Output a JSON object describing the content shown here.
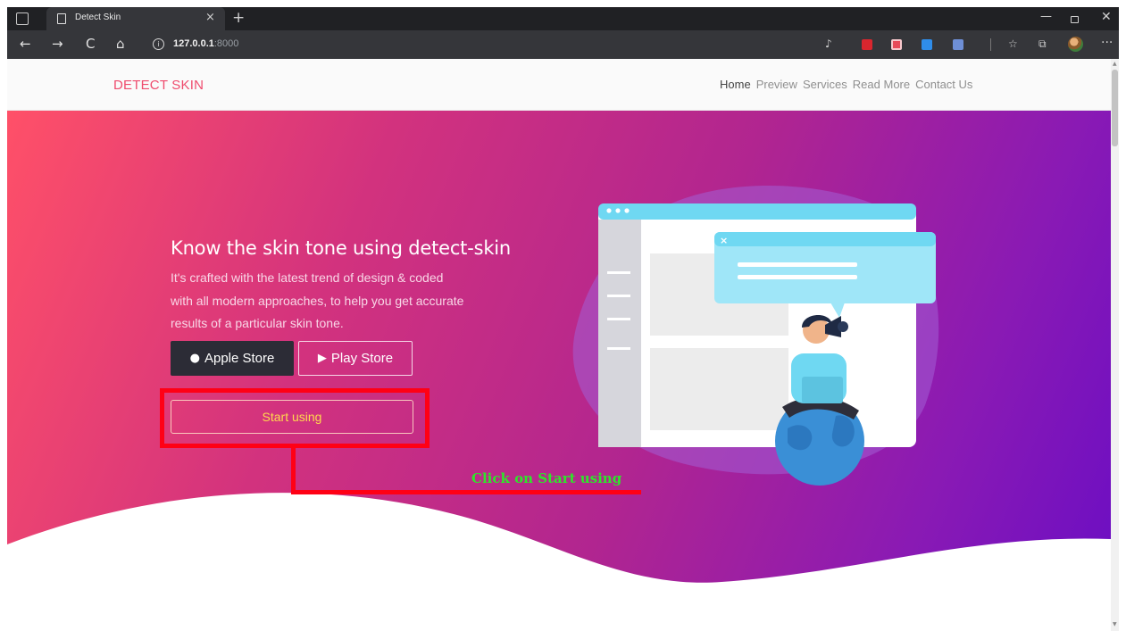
{
  "browser": {
    "tab_title": "Detect Skin",
    "tab_close": "×",
    "new_tab": "+",
    "address_host": "127.0.0.1",
    "address_port": ":8000",
    "nav_back": "←",
    "nav_forward": "→",
    "nav_reload": "C",
    "nav_home": "⌂",
    "menu": "···"
  },
  "site": {
    "brand": "DETECT SKIN",
    "nav": [
      "Home",
      "Preview",
      "Services",
      "Read More",
      "Contact Us"
    ]
  },
  "hero": {
    "title": "Know the skin tone using detect-skin",
    "subtitle_lines": [
      "It's crafted with the latest trend of design & coded",
      "with all modern approaches, to help you get accurate",
      "results of a particular skin tone."
    ],
    "apple_label": "Apple Store",
    "play_label": "Play Store",
    "start_label": "Start using"
  },
  "annotation": {
    "text": "Click on Start using"
  },
  "colors": {
    "brand": "#ef4b6d",
    "gradient_start": "#ff5068",
    "gradient_end": "#6a0dc4",
    "start_text": "#ffd84d",
    "highlight": "#ff0015",
    "annotation_text": "#2ee62a"
  }
}
